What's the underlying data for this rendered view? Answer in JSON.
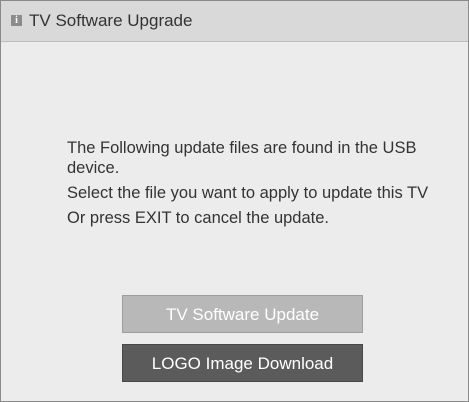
{
  "header": {
    "icon": "info-icon",
    "icon_glyph": "i",
    "title": "TV Software Upgrade"
  },
  "message": {
    "line1": "The Following update files are found in the USB device.",
    "line2": "Select the file you want to apply to update this TV",
    "line3": "Or press EXIT to cancel the update."
  },
  "buttons": {
    "update_label": "TV Software Update",
    "logo_label": "LOGO Image Download"
  },
  "colors": {
    "titlebar_bg": "#d9d9d9",
    "dialog_bg": "#ececec",
    "button_inactive": "#b8b8b8",
    "button_selected": "#5b5b5b"
  }
}
